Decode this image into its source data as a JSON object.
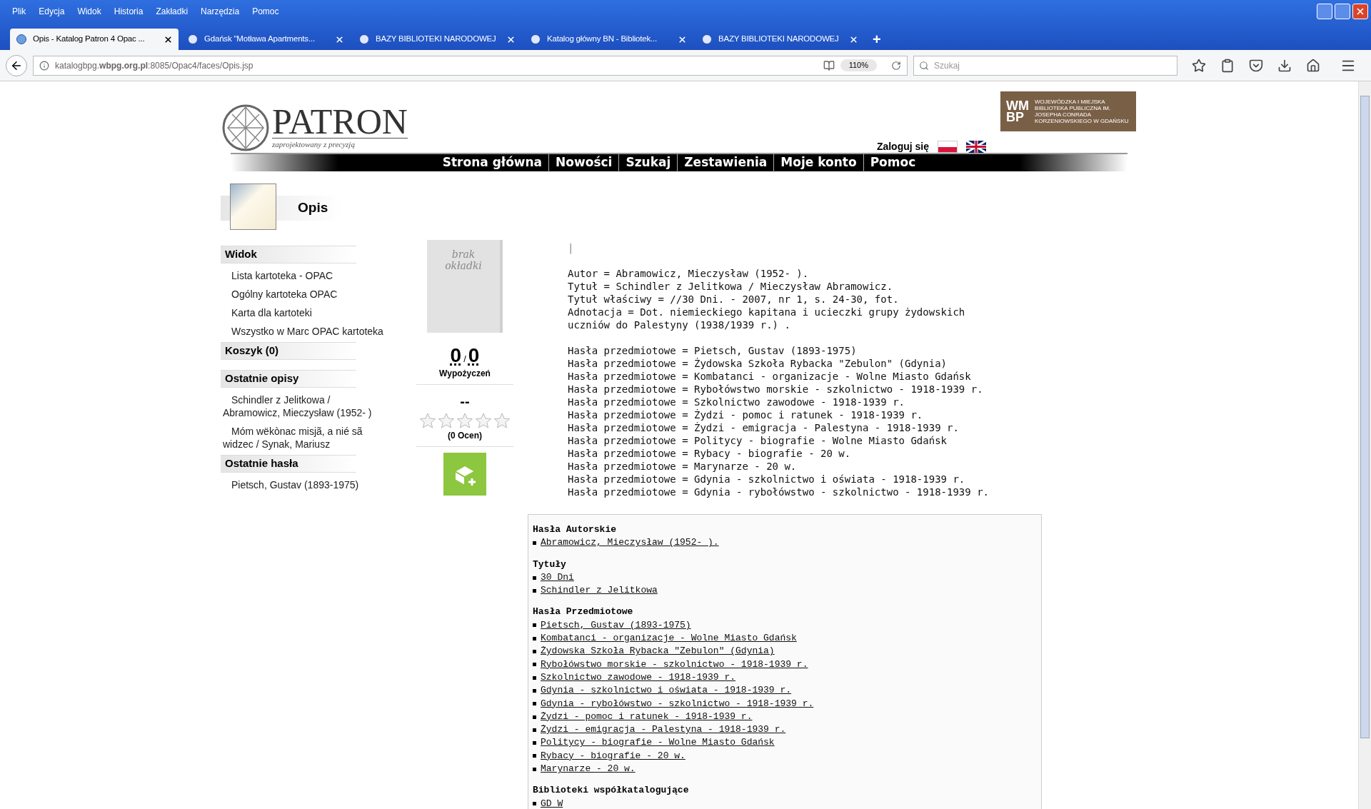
{
  "menu_bar": [
    "Plik",
    "Edycja",
    "Widok",
    "Historia",
    "Zakładki",
    "Narzędzia",
    "Pomoc"
  ],
  "tabs": [
    {
      "label": "Opis - Katalog Patron 4 Opac ...",
      "selected": true
    },
    {
      "label": "Gdańsk \"Motława Apartments...",
      "selected": false
    },
    {
      "label": "BAZY BIBLIOTEKI NARODOWEJ",
      "selected": false
    },
    {
      "label": "Katalog główny BN - Bibliotek...",
      "selected": false
    },
    {
      "label": "BAZY BIBLIOTEKI NARODOWEJ",
      "selected": false
    }
  ],
  "new_tab": "+",
  "address_bar": {
    "url": "katalogbpg.**wbpg.org.pl**:8085/Opac4/faces/Opis.jsp",
    "zoom": "110%"
  },
  "search": {
    "placeholder": "Szukaj"
  },
  "header": {
    "logo_title": "PATRON",
    "logo_tagline": "zaprojektowany z precyzją",
    "login": "Zaloguj się",
    "library_name": "WOJEWÓDZKA I MIEJSKA BIBLIOTEKA PUBLICZNA IM. JOSEPHA CONRADA KORZENIOWSKIEGO W GDAŃSKU",
    "library_logo": "WM BP"
  },
  "nav": [
    "Strona główna",
    "Nowości",
    "Szukaj",
    "Zestawienia",
    "Moje konto",
    "Pomoc"
  ],
  "page_title": "Opis",
  "sidebar": [
    {
      "heading": "Widok",
      "items": [
        "Lista kartoteka - OPAC",
        "Ogólny kartoteka OPAC",
        "Karta dla kartoteki",
        "Wszystko w Marc OPAC kartoteka"
      ]
    },
    {
      "heading": "Koszyk (0)"
    },
    {
      "heading": "Ostatnie opisy",
      "items": [
        "Schindler z Jelitkowa / Abramowicz, Mieczysław (1952- )",
        "Móm wëkònac misjã, a nié sã widzec / Synak, Mariusz"
      ]
    },
    {
      "heading": "Ostatnie hasła",
      "items": [
        "Pietsch, Gustav (1893-1975)"
      ]
    }
  ],
  "cover": {
    "text": "brak okładki"
  },
  "loans": {
    "count_a": "0",
    "separator": "/",
    "count_b": "0",
    "label": "Wypożyczeń"
  },
  "rating": {
    "score": "--",
    "stars": 0,
    "count": "(0 Ocen)"
  },
  "record": {
    "marker": "|",
    "lines": [
      "Autor = Abramowicz, Mieczysław (1952- ).",
      "Tytuł = Schindler z Jelitkowa / Mieczysław Abramowicz.",
      "Tytuł właściwy = //30 Dni. - 2007, nr 1, s. 24-30, fot.",
      "Adnotacja = Dot. niemieckiego kapitana i ucieczki grupy żydowskich uczniów do Palestyny (1938/1939 r.) ."
    ],
    "subjects": [
      "Hasła przedmiotowe = Pietsch, Gustav (1893-1975)",
      "Hasła przedmiotowe = Żydowska Szkoła Rybacka \"Zebulon\" (Gdynia)",
      "Hasła przedmiotowe = Kombatanci - organizacje - Wolne Miasto Gdańsk",
      "Hasła przedmiotowe = Rybołówstwo morskie - szkolnictwo - 1918-1939 r.",
      "Hasła przedmiotowe = Szkolnictwo zawodowe - 1918-1939 r.",
      "Hasła przedmiotowe = Żydzi - pomoc i ratunek - 1918-1939 r.",
      "Hasła przedmiotowe = Żydzi - emigracja - Palestyna - 1918-1939 r.",
      "Hasła przedmiotowe = Politycy - biografie - Wolne Miasto Gdańsk",
      "Hasła przedmiotowe = Rybacy - biografie - 20 w.",
      "Hasła przedmiotowe = Marynarze - 20 w.",
      "Hasła przedmiotowe = Gdynia - szkolnictwo i oświata - 1918-1939 r.",
      "Hasła przedmiotowe = Gdynia - rybołówstwo - szkolnictwo - 1918-1939 r."
    ]
  },
  "links_box": [
    {
      "heading": "Hasła Autorskie",
      "links": [
        "Abramowicz, Mieczysław (1952- )."
      ]
    },
    {
      "heading": "Tytuły",
      "links": [
        "30 Dni",
        "Schindler z Jelitkowa"
      ]
    },
    {
      "heading": "Hasła Przedmiotowe",
      "links": [
        "Pietsch, Gustav (1893-1975)",
        "Kombatanci - organizacje - Wolne Miasto Gdańsk",
        "Żydowska Szkoła Rybacka \"Zebulon\" (Gdynia)",
        "Rybołówstwo morskie - szkolnictwo - 1918-1939 r.",
        "Szkolnictwo zawodowe - 1918-1939 r.",
        "Gdynia - szkolnictwo i oświata - 1918-1939 r.",
        "Gdynia - rybołówstwo - szkolnictwo - 1918-1939 r.",
        "Żydzi - pomoc i ratunek - 1918-1939 r.",
        "Żydzi - emigracja - Palestyna - 1918-1939 r.",
        "Politycy - biografie - Wolne Miasto Gdańsk",
        "Rybacy - biografie - 20 w.",
        "Marynarze - 20 w."
      ]
    },
    {
      "heading": "Biblioteki współkatalogujące",
      "links": [
        "GD W"
      ]
    }
  ]
}
